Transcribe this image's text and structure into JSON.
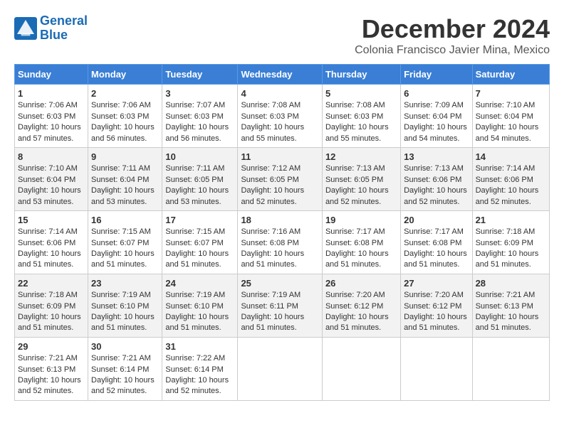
{
  "header": {
    "logo_line1": "General",
    "logo_line2": "Blue",
    "title": "December 2024",
    "subtitle": "Colonia Francisco Javier Mina, Mexico"
  },
  "days_of_week": [
    "Sunday",
    "Monday",
    "Tuesday",
    "Wednesday",
    "Thursday",
    "Friday",
    "Saturday"
  ],
  "weeks": [
    [
      {
        "day": "1",
        "sunrise": "7:06 AM",
        "sunset": "6:03 PM",
        "daylight": "10 hours and 57 minutes."
      },
      {
        "day": "2",
        "sunrise": "7:06 AM",
        "sunset": "6:03 PM",
        "daylight": "10 hours and 56 minutes."
      },
      {
        "day": "3",
        "sunrise": "7:07 AM",
        "sunset": "6:03 PM",
        "daylight": "10 hours and 56 minutes."
      },
      {
        "day": "4",
        "sunrise": "7:08 AM",
        "sunset": "6:03 PM",
        "daylight": "10 hours and 55 minutes."
      },
      {
        "day": "5",
        "sunrise": "7:08 AM",
        "sunset": "6:03 PM",
        "daylight": "10 hours and 55 minutes."
      },
      {
        "day": "6",
        "sunrise": "7:09 AM",
        "sunset": "6:04 PM",
        "daylight": "10 hours and 54 minutes."
      },
      {
        "day": "7",
        "sunrise": "7:10 AM",
        "sunset": "6:04 PM",
        "daylight": "10 hours and 54 minutes."
      }
    ],
    [
      {
        "day": "8",
        "sunrise": "7:10 AM",
        "sunset": "6:04 PM",
        "daylight": "10 hours and 53 minutes."
      },
      {
        "day": "9",
        "sunrise": "7:11 AM",
        "sunset": "6:04 PM",
        "daylight": "10 hours and 53 minutes."
      },
      {
        "day": "10",
        "sunrise": "7:11 AM",
        "sunset": "6:05 PM",
        "daylight": "10 hours and 53 minutes."
      },
      {
        "day": "11",
        "sunrise": "7:12 AM",
        "sunset": "6:05 PM",
        "daylight": "10 hours and 52 minutes."
      },
      {
        "day": "12",
        "sunrise": "7:13 AM",
        "sunset": "6:05 PM",
        "daylight": "10 hours and 52 minutes."
      },
      {
        "day": "13",
        "sunrise": "7:13 AM",
        "sunset": "6:06 PM",
        "daylight": "10 hours and 52 minutes."
      },
      {
        "day": "14",
        "sunrise": "7:14 AM",
        "sunset": "6:06 PM",
        "daylight": "10 hours and 52 minutes."
      }
    ],
    [
      {
        "day": "15",
        "sunrise": "7:14 AM",
        "sunset": "6:06 PM",
        "daylight": "10 hours and 51 minutes."
      },
      {
        "day": "16",
        "sunrise": "7:15 AM",
        "sunset": "6:07 PM",
        "daylight": "10 hours and 51 minutes."
      },
      {
        "day": "17",
        "sunrise": "7:15 AM",
        "sunset": "6:07 PM",
        "daylight": "10 hours and 51 minutes."
      },
      {
        "day": "18",
        "sunrise": "7:16 AM",
        "sunset": "6:08 PM",
        "daylight": "10 hours and 51 minutes."
      },
      {
        "day": "19",
        "sunrise": "7:17 AM",
        "sunset": "6:08 PM",
        "daylight": "10 hours and 51 minutes."
      },
      {
        "day": "20",
        "sunrise": "7:17 AM",
        "sunset": "6:08 PM",
        "daylight": "10 hours and 51 minutes."
      },
      {
        "day": "21",
        "sunrise": "7:18 AM",
        "sunset": "6:09 PM",
        "daylight": "10 hours and 51 minutes."
      }
    ],
    [
      {
        "day": "22",
        "sunrise": "7:18 AM",
        "sunset": "6:09 PM",
        "daylight": "10 hours and 51 minutes."
      },
      {
        "day": "23",
        "sunrise": "7:19 AM",
        "sunset": "6:10 PM",
        "daylight": "10 hours and 51 minutes."
      },
      {
        "day": "24",
        "sunrise": "7:19 AM",
        "sunset": "6:10 PM",
        "daylight": "10 hours and 51 minutes."
      },
      {
        "day": "25",
        "sunrise": "7:19 AM",
        "sunset": "6:11 PM",
        "daylight": "10 hours and 51 minutes."
      },
      {
        "day": "26",
        "sunrise": "7:20 AM",
        "sunset": "6:12 PM",
        "daylight": "10 hours and 51 minutes."
      },
      {
        "day": "27",
        "sunrise": "7:20 AM",
        "sunset": "6:12 PM",
        "daylight": "10 hours and 51 minutes."
      },
      {
        "day": "28",
        "sunrise": "7:21 AM",
        "sunset": "6:13 PM",
        "daylight": "10 hours and 51 minutes."
      }
    ],
    [
      {
        "day": "29",
        "sunrise": "7:21 AM",
        "sunset": "6:13 PM",
        "daylight": "10 hours and 52 minutes."
      },
      {
        "day": "30",
        "sunrise": "7:21 AM",
        "sunset": "6:14 PM",
        "daylight": "10 hours and 52 minutes."
      },
      {
        "day": "31",
        "sunrise": "7:22 AM",
        "sunset": "6:14 PM",
        "daylight": "10 hours and 52 minutes."
      },
      {
        "day": "",
        "sunrise": "",
        "sunset": "",
        "daylight": ""
      },
      {
        "day": "",
        "sunrise": "",
        "sunset": "",
        "daylight": ""
      },
      {
        "day": "",
        "sunrise": "",
        "sunset": "",
        "daylight": ""
      },
      {
        "day": "",
        "sunrise": "",
        "sunset": "",
        "daylight": ""
      }
    ]
  ]
}
